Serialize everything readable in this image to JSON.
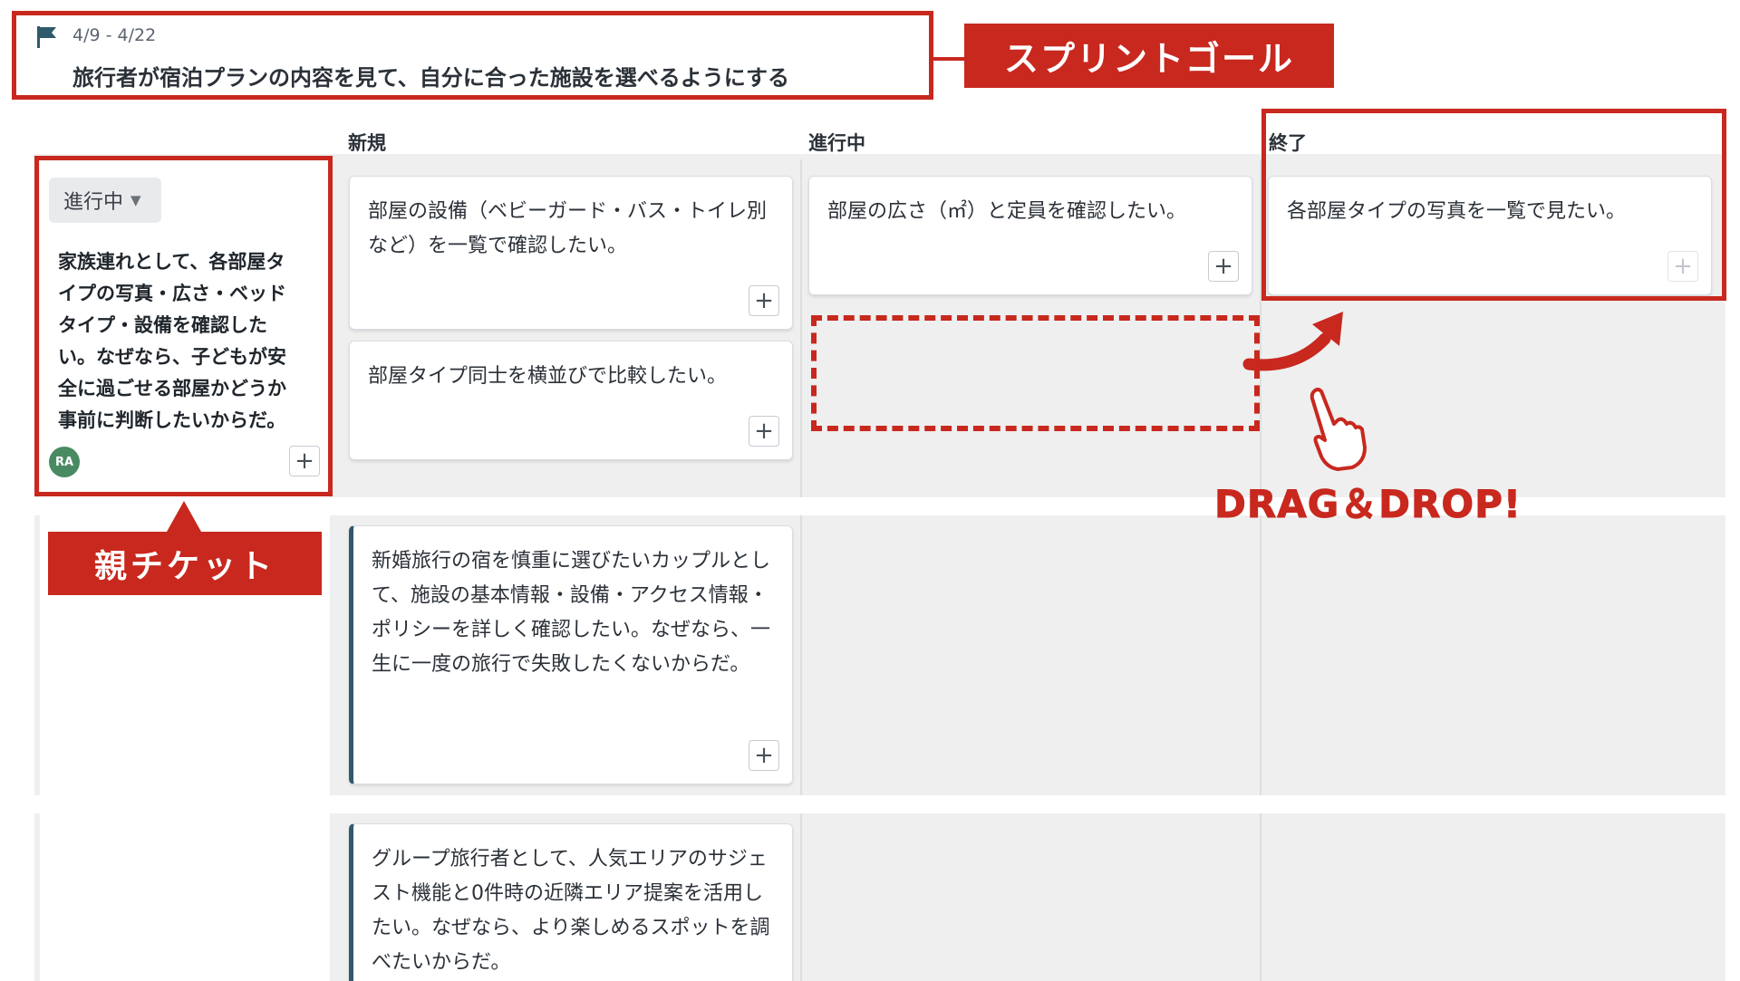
{
  "sprint": {
    "date_range": "4/9 - 4/22",
    "goal": "旅行者が宿泊プランの内容を見て、自分に合った施設を選べるようにする",
    "goal_callout": "スプリントゴール"
  },
  "columns": [
    {
      "label": "新規"
    },
    {
      "label": "進行中"
    },
    {
      "label": "終了"
    }
  ],
  "parent_ticket": {
    "status": "進行中",
    "text": "家族連れとして、各部屋タイプの写真・広さ・ベッドタイプ・設備を確認したい。なぜなら、子どもが安全に過ごせる部屋かどうか事前に判断したいからだ。",
    "avatar": "RA",
    "label": "親チケット"
  },
  "cards": {
    "new_1": "部屋の設備（ベビーガード・バス・トイレ別など）を一覧で確認したい。",
    "new_2": "部屋タイプ同士を横並びで比較したい。",
    "in_progress_1": "部屋の広さ（㎡）と定員を確認したい。",
    "done_1": "各部屋タイプの写真を一覧で見たい。",
    "row2_new": "新婚旅行の宿を慎重に選びたいカップルとして、施設の基本情報・設備・アクセス情報・ポリシーを詳しく確認したい。なぜなら、一生に一度の旅行で失敗したくないからだ。",
    "row3_new": "グループ旅行者として、人気エリアのサジェスト機能と0件時の近隣エリア提案を活用したい。なぜなら、より楽しめるスポットを調べたいからだ。"
  },
  "add_symbol": "+",
  "annotation": {
    "drag_drop": "DRAG＆DROP!"
  },
  "colors": {
    "annotation_red": "#c8281e",
    "card_accent": "#2f5a6b",
    "board_bg": "#efefef",
    "avatar_bg": "#4a8a62"
  },
  "icons": [
    "flag-icon",
    "chevron-down-icon",
    "plus-icon",
    "curved-arrow-icon",
    "pointing-hand-icon"
  ]
}
